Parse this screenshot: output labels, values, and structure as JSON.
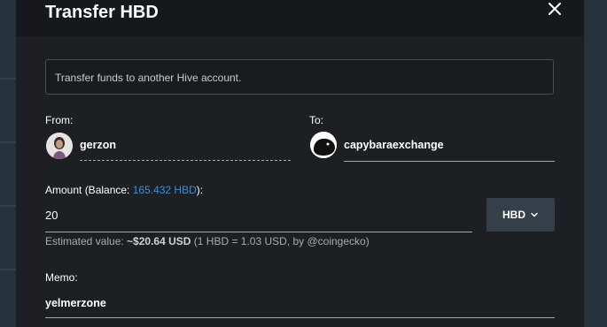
{
  "dialog": {
    "title": "Transfer HBD",
    "info": "Transfer funds to another Hive account."
  },
  "from": {
    "label": "From:",
    "account": "gerzon"
  },
  "to": {
    "label": "To:",
    "account": "capybaraexchange"
  },
  "amount": {
    "label_prefix": "Amount (Balance: ",
    "balance": "165.432 HBD",
    "label_suffix": "):",
    "value": "20",
    "asset": "HBD"
  },
  "estimate": {
    "prefix": "Estimated value: ",
    "value": "~$20.64 USD",
    "suffix": " (1 HBD = 1.03 USD, by @coingecko)"
  },
  "memo": {
    "label": "Memo:",
    "value": "yelmerzone"
  },
  "icons": {
    "close": "close-icon",
    "asset_dropdown": "chevron-down-icon"
  },
  "colors": {
    "link": "#3d8fd6",
    "modal_bg": "#1e1f22",
    "asset_button": "#343f49"
  }
}
